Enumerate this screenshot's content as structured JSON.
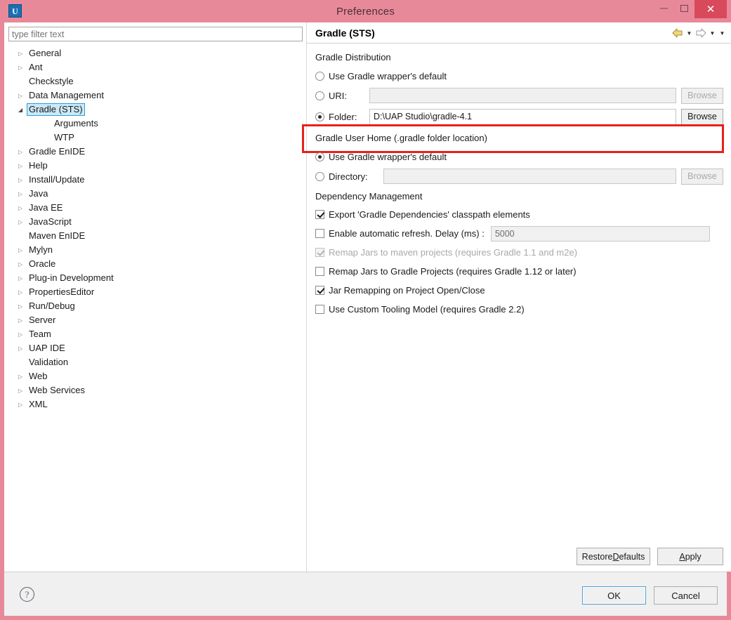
{
  "window": {
    "title": "Preferences",
    "app_icon": "U",
    "minimize_label": "–",
    "maximize_label": "❐",
    "close_label": "✕"
  },
  "sidebar": {
    "filter": {
      "placeholder": "type filter text",
      "value": ""
    },
    "items": [
      {
        "label": "General",
        "expandable": true,
        "selected": false,
        "child": false
      },
      {
        "label": "Ant",
        "expandable": true,
        "selected": false,
        "child": false
      },
      {
        "label": "Checkstyle",
        "expandable": false,
        "selected": false,
        "child": false
      },
      {
        "label": "Data Management",
        "expandable": true,
        "selected": false,
        "child": false
      },
      {
        "label": "Gradle (STS)",
        "expandable": true,
        "selected": true,
        "child": false,
        "expanded": true
      },
      {
        "label": "Arguments",
        "expandable": false,
        "selected": false,
        "child": true
      },
      {
        "label": "WTP",
        "expandable": false,
        "selected": false,
        "child": true
      },
      {
        "label": "Gradle EnIDE",
        "expandable": true,
        "selected": false,
        "child": false
      },
      {
        "label": "Help",
        "expandable": true,
        "selected": false,
        "child": false
      },
      {
        "label": "Install/Update",
        "expandable": true,
        "selected": false,
        "child": false
      },
      {
        "label": "Java",
        "expandable": true,
        "selected": false,
        "child": false
      },
      {
        "label": "Java EE",
        "expandable": true,
        "selected": false,
        "child": false
      },
      {
        "label": "JavaScript",
        "expandable": true,
        "selected": false,
        "child": false
      },
      {
        "label": "Maven EnIDE",
        "expandable": false,
        "selected": false,
        "child": false
      },
      {
        "label": "Mylyn",
        "expandable": true,
        "selected": false,
        "child": false
      },
      {
        "label": "Oracle",
        "expandable": true,
        "selected": false,
        "child": false
      },
      {
        "label": "Plug-in Development",
        "expandable": true,
        "selected": false,
        "child": false
      },
      {
        "label": "PropertiesEditor",
        "expandable": true,
        "selected": false,
        "child": false
      },
      {
        "label": "Run/Debug",
        "expandable": true,
        "selected": false,
        "child": false
      },
      {
        "label": "Server",
        "expandable": true,
        "selected": false,
        "child": false
      },
      {
        "label": "Team",
        "expandable": true,
        "selected": false,
        "child": false
      },
      {
        "label": "UAP IDE",
        "expandable": true,
        "selected": false,
        "child": false
      },
      {
        "label": "Validation",
        "expandable": false,
        "selected": false,
        "child": false
      },
      {
        "label": "Web",
        "expandable": true,
        "selected": false,
        "child": false
      },
      {
        "label": "Web Services",
        "expandable": true,
        "selected": false,
        "child": false
      },
      {
        "label": "XML",
        "expandable": true,
        "selected": false,
        "child": false
      }
    ]
  },
  "panel": {
    "title": "Gradle (STS)",
    "nav": {
      "back_icon": "back-arrow",
      "back_caret": "▼",
      "forward_icon": "forward-arrow",
      "forward_caret": "▼",
      "menu_caret": "▼"
    },
    "distribution": {
      "group_label": "Gradle Distribution",
      "wrapper_option": "Use Gradle wrapper's default",
      "wrapper_selected": false,
      "uri_label": "URI:",
      "uri_selected": false,
      "uri_value": "",
      "uri_browse": "Browse",
      "folder_label": "Folder:",
      "folder_selected": true,
      "folder_value": "D:\\UAP Studio\\gradle-4.1",
      "folder_browse": "Browse"
    },
    "user_home": {
      "group_label": "Gradle User Home (.gradle folder location)",
      "wrapper_option": "Use Gradle wrapper's default",
      "wrapper_selected": true,
      "directory_label": "Directory:",
      "directory_selected": false,
      "directory_value": "",
      "directory_browse": "Browse"
    },
    "dependency_management": {
      "group_label": "Dependency Management",
      "options": [
        {
          "label": "Export 'Gradle Dependencies' classpath elements",
          "checked": true,
          "disabled": false,
          "has_field": false
        },
        {
          "label": "Enable automatic refresh. Delay (ms) :",
          "checked": false,
          "disabled": false,
          "has_field": true,
          "field_value": "5000"
        },
        {
          "label": "Remap Jars to maven projects (requires Gradle 1.1 and m2e)",
          "checked": true,
          "disabled": true,
          "has_field": false
        },
        {
          "label": "Remap Jars to Gradle Projects (requires Gradle 1.12 or later)",
          "checked": false,
          "disabled": false,
          "has_field": false
        },
        {
          "label": "Jar Remapping on Project Open/Close",
          "checked": true,
          "disabled": false,
          "has_field": false
        },
        {
          "label": "Use Custom Tooling Model (requires Gradle 2.2)",
          "checked": false,
          "disabled": false,
          "has_field": false
        }
      ]
    },
    "actions": {
      "restore_defaults_pre": "Restore ",
      "restore_defaults_mnemonic": "D",
      "restore_defaults_post": "efaults",
      "apply_mnemonic": "A",
      "apply_post": "pply"
    }
  },
  "footer": {
    "help_icon": "?",
    "ok_label": "OK",
    "cancel_label": "Cancel"
  },
  "colors": {
    "titlebar": "#e8899a",
    "close_button": "#d9495c",
    "annotation": "#e8201a",
    "selection": "#cbe8f6",
    "selection_border": "#26a0da",
    "focus_border": "#4a9fd8"
  }
}
